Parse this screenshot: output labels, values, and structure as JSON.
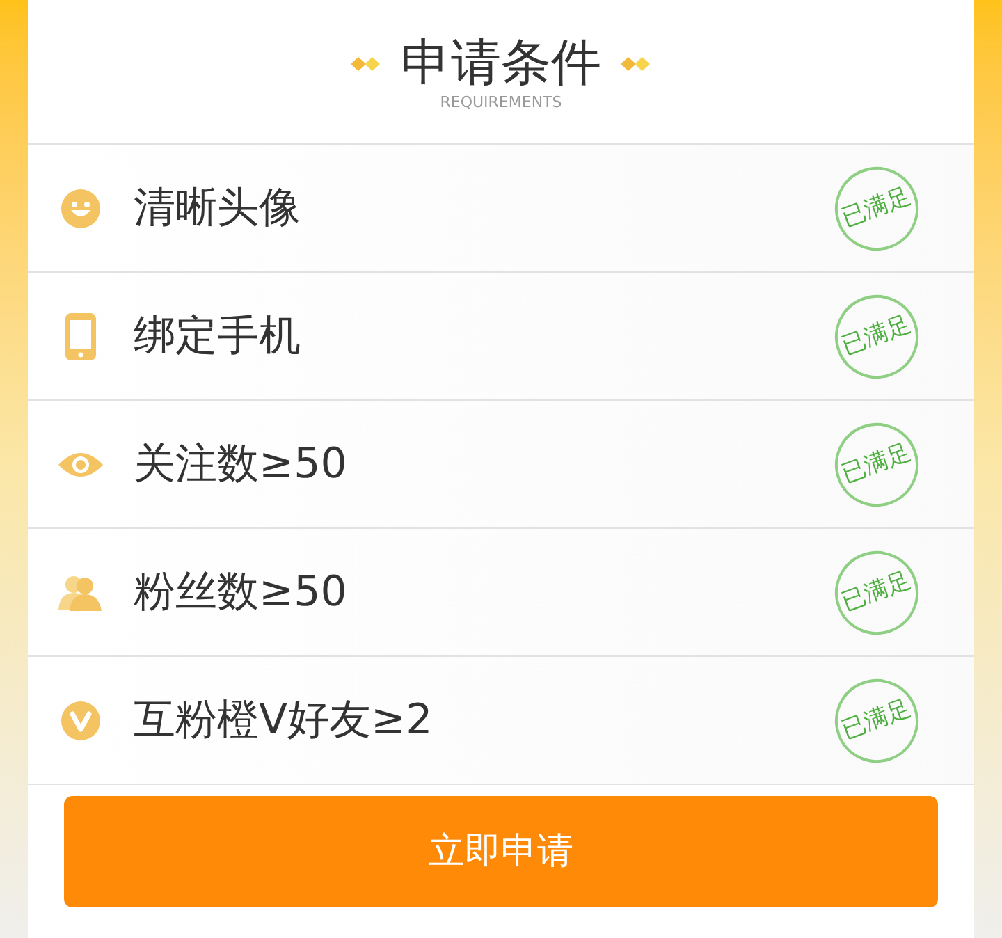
{
  "header": {
    "title": "申请条件",
    "subtitle": "REQUIREMENTS"
  },
  "requirements": [
    {
      "label": "清晰头像",
      "met": true,
      "stamp": "已满足"
    },
    {
      "label": "绑定手机",
      "met": true,
      "stamp": "已满足"
    },
    {
      "label": "关注数≥50",
      "met": true,
      "stamp": "已满足"
    },
    {
      "label": "粉丝数≥50",
      "met": true,
      "stamp": "已满足"
    },
    {
      "label": "互粉橙V好友≥2",
      "met": true,
      "stamp": "已满足"
    }
  ],
  "apply_button": "立即申请"
}
